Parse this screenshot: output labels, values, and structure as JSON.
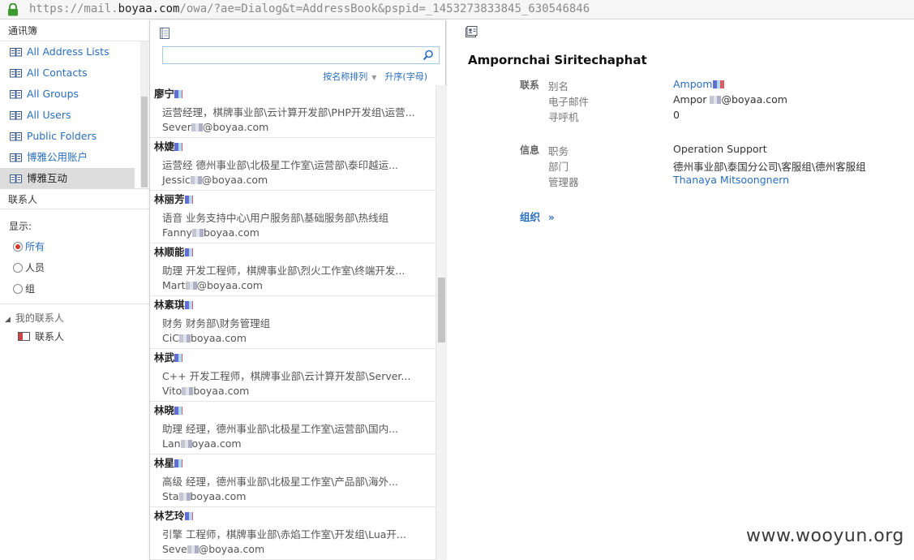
{
  "browser": {
    "url_prefix": "https://mail.",
    "url_host": "boyaa.com",
    "url_rest": "/owa/?ae=Dialog&t=AddressBook&pspid=_1453273833845_630546846"
  },
  "left": {
    "header": "通讯簿",
    "nav_items": [
      {
        "label": "All Address Lists",
        "selected": false
      },
      {
        "label": "All Contacts",
        "selected": false
      },
      {
        "label": "All Groups",
        "selected": false
      },
      {
        "label": "All Users",
        "selected": false
      },
      {
        "label": "Public Folders",
        "selected": false
      },
      {
        "label": "博雅公用账户",
        "selected": false
      },
      {
        "label": "博雅互动",
        "selected": true
      }
    ],
    "contacts_header": "联系人",
    "show_label": "显示:",
    "filters": [
      {
        "label": "所有",
        "checked": true
      },
      {
        "label": "人员",
        "checked": false
      },
      {
        "label": "组",
        "checked": false
      }
    ],
    "my_contacts_group": "我的联系人",
    "my_contacts_item": "联系人"
  },
  "middle": {
    "search_value": "",
    "sort_by_label": "按名称排列",
    "sort_order_label": "升序(字母)",
    "entries": [
      {
        "name": "廖宁",
        "desc": "运营经理，棋牌事业部\\云计算开发部\\PHP开发组\\运营...",
        "email_pre": "Sever",
        "email_post": "@boyaa.com"
      },
      {
        "name": "林婕",
        "desc": "运营经 德州事业部\\北极星工作室\\运营部\\泰印越运...",
        "email_pre": "Jessic",
        "email_post": "@boyaa.com"
      },
      {
        "name": "林丽芳",
        "desc": "语音 业务支持中心\\用户服务部\\基础服务部\\热线组",
        "email_pre": "Fanny",
        "email_post": "boyaa.com"
      },
      {
        "name": "林顺能",
        "desc": "助理 开发工程师，棋牌事业部\\烈火工作室\\终端开发...",
        "email_pre": "Mart",
        "email_post": "@boyaa.com"
      },
      {
        "name": "林素琪",
        "desc": "财务 财务部\\财务管理组",
        "email_pre": "CiC",
        "email_post": "boyaa.com"
      },
      {
        "name": "林武",
        "desc": "C++ 开发工程师，棋牌事业部\\云计算开发部\\Server...",
        "email_pre": "Vito",
        "email_post": "boyaa.com"
      },
      {
        "name": "林晓",
        "desc": "助理 经理，德州事业部\\北极星工作室\\运营部\\国内...",
        "email_pre": "Lan",
        "email_post": "oyaa.com"
      },
      {
        "name": "林星",
        "desc": "高级 经理，德州事业部\\北极星工作室\\产品部\\海外...",
        "email_pre": "Sta",
        "email_post": "boyaa.com"
      },
      {
        "name": "林艺玲",
        "desc": "引擎 工程师，棋牌事业部\\赤焰工作室\\开发组\\Lua开...",
        "email_pre": "Seve",
        "email_post": "@boyaa.com"
      }
    ]
  },
  "details": {
    "name": "Ampornchai Siritechaphat",
    "contact_section": "联系",
    "alias_label": "别名",
    "alias_value": "Ampom",
    "email_label": "电子邮件",
    "email_pre": "Ampor",
    "email_post": "@boyaa.com",
    "pager_label": "寻呼机",
    "pager_value": "0",
    "info_section": "信息",
    "title_label": "职务",
    "title_value": "Operation Support",
    "dept_label": "部门",
    "dept_value": "德州事业部\\泰国分公司\\客服组\\德州客服组",
    "manager_label": "管理器",
    "manager_value": "Thanaya Mitsoongnern",
    "org_toggle": "组织"
  },
  "watermark": "www.wooyun.org",
  "colors": {
    "link": "#2a6ebb",
    "selected_nav_bg": "#dcdcdc",
    "radio_dot": "#d9372b"
  }
}
